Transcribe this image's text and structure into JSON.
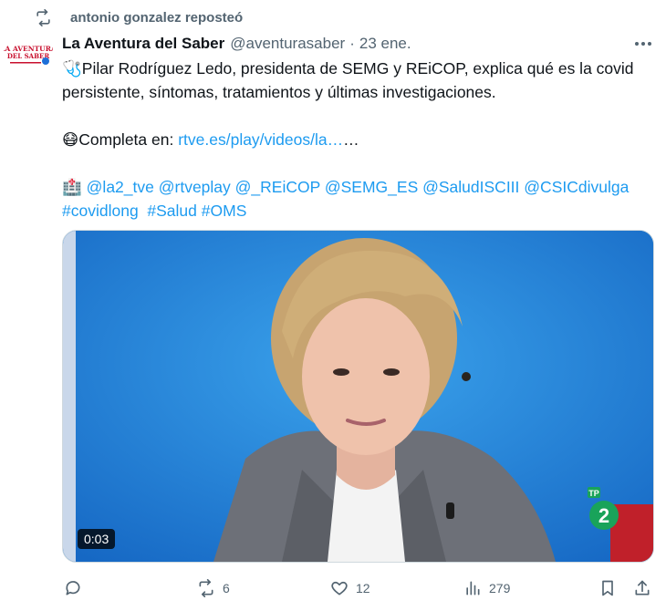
{
  "repost": {
    "text": "antonio gonzalez reposteó"
  },
  "author": {
    "avatar_text": [
      "LA AVENTURA",
      "DEL SABER"
    ],
    "name": "La Aventura del Saber",
    "handle": "@aventurasaber",
    "separator": "·",
    "date": "23 ene."
  },
  "tweet": {
    "line1_emoji": "🩺",
    "line1_text": "Pilar  Rodríguez Ledo, presidenta de SEMG y REiCOP, explica qué es la covid persistente, síntomas, tratamientos y últimas investigaciones.",
    "line2_emoji": "😷",
    "line2_prefix": "Completa en: ",
    "line2_link": "rtve.es/play/videos/la…",
    "line2_suffix": "…",
    "line3_emoji": "🏥",
    "mentions": [
      "@la2_tve",
      "@rtveplay",
      "@_REiCOP",
      "@SEMG_ES",
      "@SaludISCIII",
      "@CSICdivulga"
    ],
    "hashtags": [
      "#covidlong",
      "#Salud",
      "#OMS"
    ]
  },
  "media": {
    "timestamp": "0:03",
    "channel_logo": "2"
  },
  "actions": {
    "reply_count": "",
    "repost_count": "6",
    "like_count": "12",
    "views_count": "279"
  }
}
